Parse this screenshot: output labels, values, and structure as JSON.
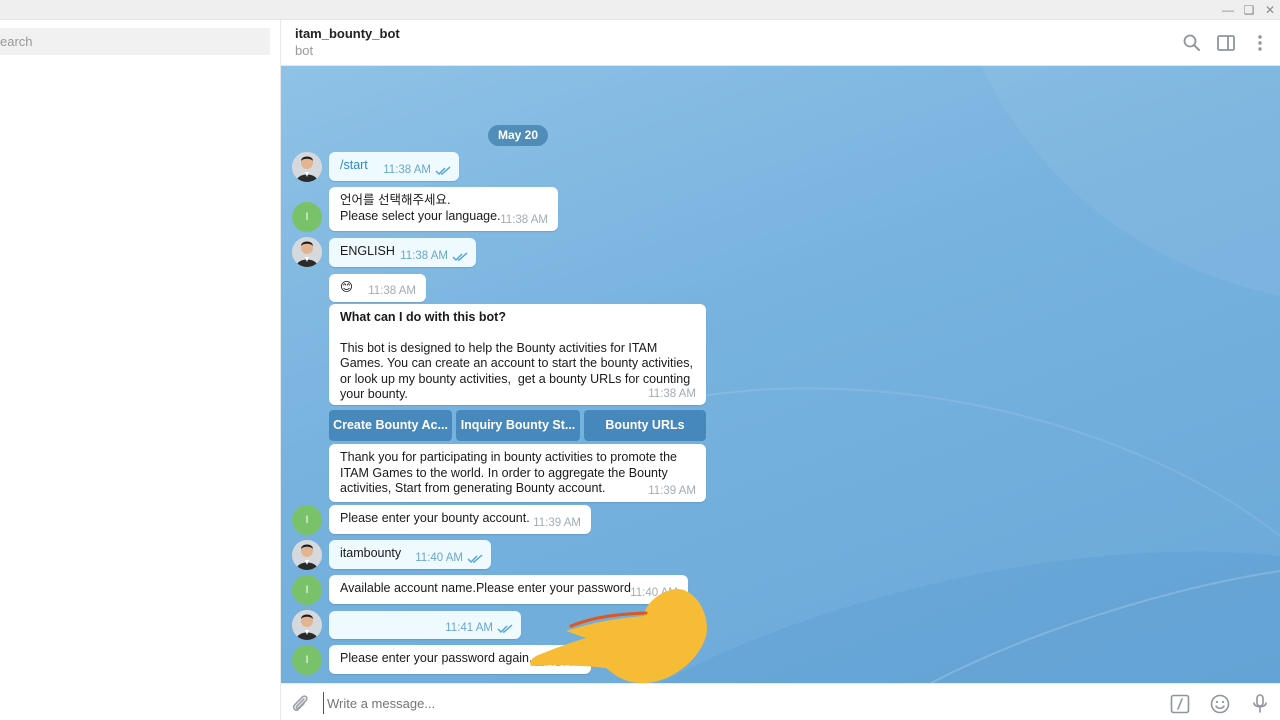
{
  "sidebar": {
    "search_placeholder": "Search",
    "search_visible": "earch"
  },
  "header": {
    "title": "itam_bounty_bot",
    "subtitle": "bot"
  },
  "chat": {
    "date": "May 20",
    "messages": [
      {
        "text": "/start",
        "time": "11:38 AM"
      },
      {
        "text": "언어를 선택해주세요.\nPlease select your language.",
        "time": "11:38 AM"
      },
      {
        "text": "ENGLISH",
        "time": "11:38 AM"
      },
      {
        "text": "😊",
        "time": "11:38 AM"
      },
      {
        "title": "What can I do with this bot?",
        "text": "This bot is designed to help the Bounty activities for ITAM Games. You can create an account to start the bounty activities, or look up my bounty activities,  get a bounty URLs for counting your bounty.",
        "time": "11:38 AM"
      },
      {
        "text": "Thank you for participating in bounty activities to promote the ITAM Games to the world. In order to aggregate the Bounty activities, Start from generating Bounty account.",
        "time": "11:39 AM"
      },
      {
        "text": "Please enter your bounty account.",
        "time": "11:39 AM"
      },
      {
        "text": "itambounty",
        "time": "11:40 AM"
      },
      {
        "text": "Available account name.Please enter your password",
        "time": "11:40 AM"
      },
      {
        "text": "",
        "time": "11:41 AM"
      },
      {
        "text": "Please enter your password again.",
        "time": "11:41 AM"
      }
    ],
    "keyboard": [
      "Create Bounty Ac...",
      "Inquiry Bounty St...",
      "Bounty URLs"
    ],
    "bot_avatar_letter": "I"
  },
  "composer": {
    "placeholder": "Write a message..."
  },
  "colors": {
    "accent": "#2a8bcb",
    "chat_bg": "#78b3df",
    "bot_avatar": "#7ac26a",
    "pointer_hand": "#f7bc35"
  },
  "icons": [
    "search-icon",
    "sidebar-toggle-icon",
    "more-vertical-icon",
    "attach-icon",
    "bot-command-icon",
    "emoji-icon",
    "microphone-icon",
    "double-check-icon"
  ]
}
